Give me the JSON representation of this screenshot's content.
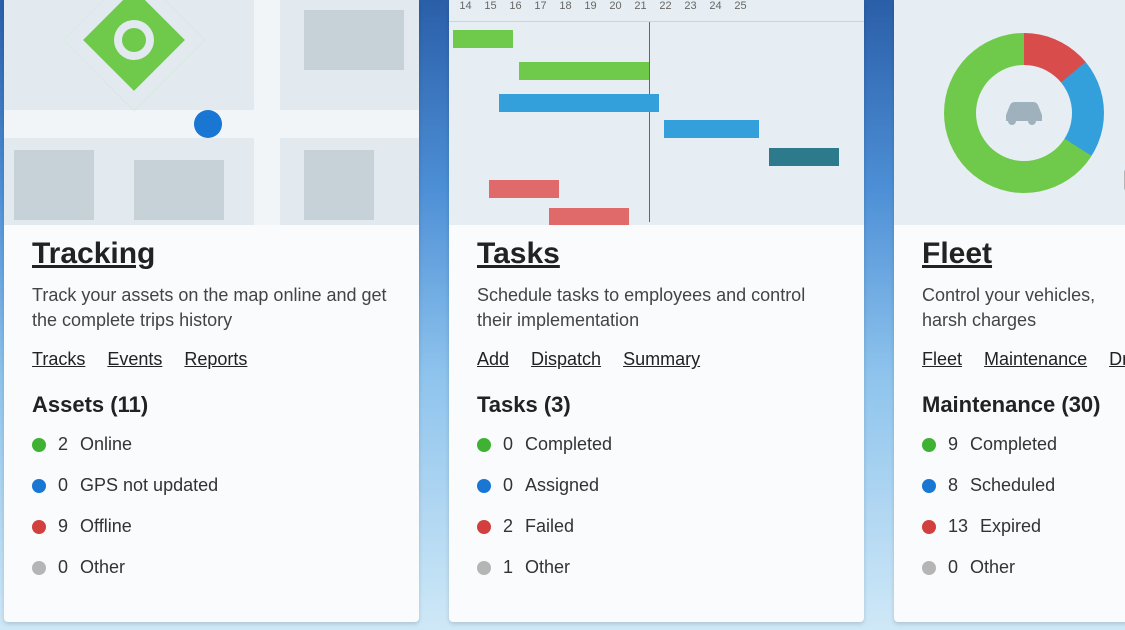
{
  "cards": [
    {
      "title": "Tracking",
      "desc": "Track your assets on the map online and get the complete trips history",
      "links": [
        "Tracks",
        "Events",
        "Reports"
      ],
      "stat_title": "Assets (11)",
      "stats": [
        {
          "count": "2",
          "label": "Online"
        },
        {
          "count": "0",
          "label": "GPS not updated"
        },
        {
          "count": "9",
          "label": "Offline"
        },
        {
          "count": "0",
          "label": "Other"
        }
      ]
    },
    {
      "title": "Tasks",
      "desc": "Schedule tasks to employees and control their implementation",
      "links": [
        "Add",
        "Dispatch",
        "Summary"
      ],
      "stat_title": "Tasks (3)",
      "stats": [
        {
          "count": "0",
          "label": "Completed"
        },
        {
          "count": "0",
          "label": "Assigned"
        },
        {
          "count": "2",
          "label": "Failed"
        },
        {
          "count": "1",
          "label": "Other"
        }
      ]
    },
    {
      "title": "Fleet",
      "desc": "Control your vehicles, harsh charges",
      "links": [
        "Fleet",
        "Maintenance",
        "Driv"
      ],
      "stat_title": "Maintenance (30)",
      "stats": [
        {
          "count": "9",
          "label": "Completed"
        },
        {
          "count": "8",
          "label": "Scheduled"
        },
        {
          "count": "13",
          "label": "Expired"
        },
        {
          "count": "0",
          "label": "Other"
        }
      ]
    }
  ],
  "gantt_ticks": [
    "14",
    "15",
    "16",
    "17",
    "18",
    "19",
    "20",
    "21",
    "22",
    "23",
    "24",
    "25"
  ],
  "dot_colors": [
    "green",
    "blue",
    "red",
    "gray"
  ]
}
